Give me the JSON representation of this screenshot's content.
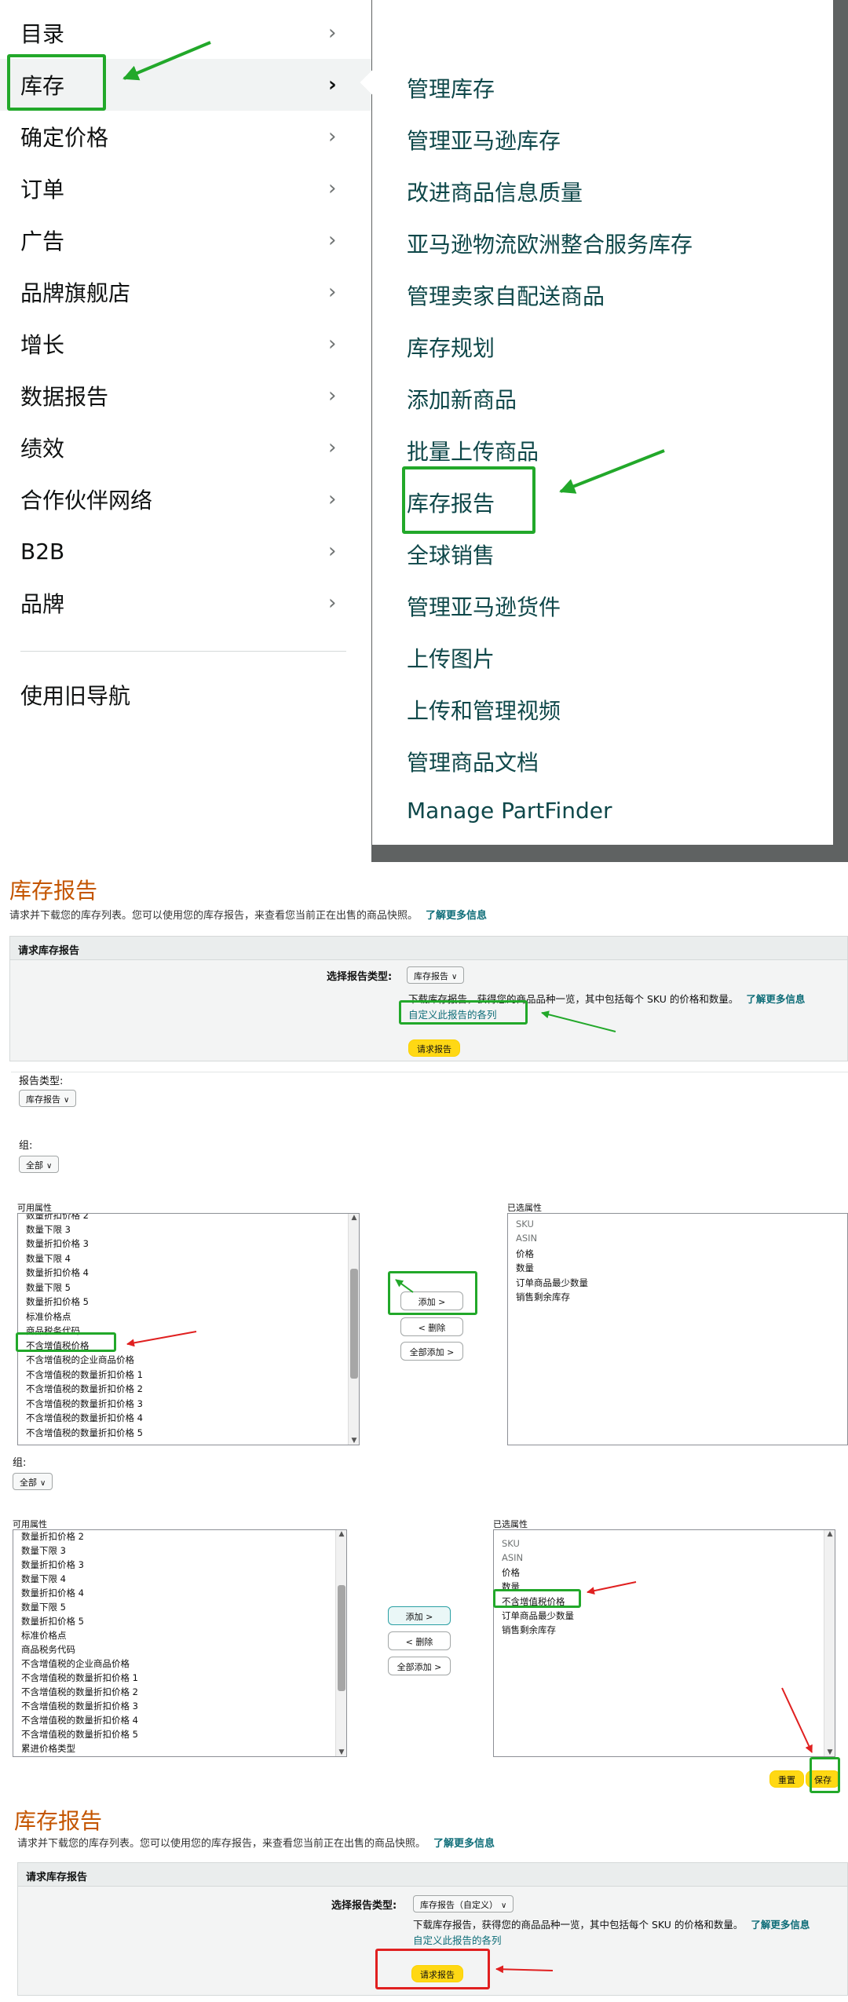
{
  "nav": {
    "left_items": [
      {
        "label": "目录"
      },
      {
        "label": "库存"
      },
      {
        "label": "确定价格"
      },
      {
        "label": "订单"
      },
      {
        "label": "广告"
      },
      {
        "label": "品牌旗舰店"
      },
      {
        "label": "增长"
      },
      {
        "label": "数据报告"
      },
      {
        "label": "绩效"
      },
      {
        "label": "合作伙伴网络"
      },
      {
        "label": "B2B"
      },
      {
        "label": "品牌"
      }
    ],
    "chevron": "›",
    "old_nav": "使用旧导航",
    "sub_items": [
      {
        "label": "管理库存"
      },
      {
        "label": "管理亚马逊库存"
      },
      {
        "label": "改进商品信息质量"
      },
      {
        "label": "亚马逊物流欧洲整合服务库存"
      },
      {
        "label": "管理卖家自配送商品"
      },
      {
        "label": "库存规划"
      },
      {
        "label": "添加新商品"
      },
      {
        "label": "批量上传商品"
      },
      {
        "label": "库存报告"
      },
      {
        "label": "全球销售"
      },
      {
        "label": "管理亚马逊货件"
      },
      {
        "label": "上传图片"
      },
      {
        "label": "上传和管理视频"
      },
      {
        "label": "管理商品文档"
      },
      {
        "label": "Manage PartFinder"
      }
    ]
  },
  "report_top": {
    "title": "库存报告",
    "subtitle": "请求并下载您的库存列表。您可以使用您的库存报告，来查看您当前正在出售的商品快照。",
    "learn_more": "了解更多信息",
    "panel_title": "请求库存报告",
    "type_label": "选择报告类型:",
    "type_value": "库存报告",
    "description": "下载库存报告，获得您的商品品种一览，其中包括每个 SKU 的价格和数量。",
    "customize_link": "自定义此报告的各列",
    "request_button": "请求报告"
  },
  "columns_editor": {
    "report_type_label": "报告类型:",
    "report_type_value": "库存报告",
    "group_label": "组:",
    "group_value": "全部",
    "available_label": "可用属性",
    "selected_label": "已选属性",
    "available_rows_a": [
      "数量折扣价格 2",
      "数量下限 3",
      "数量折扣价格 3",
      "数量下限 4",
      "数量折扣价格 4",
      "数量下限 5",
      "数量折扣价格 5",
      "标准价格点",
      "商品税务代码",
      "不含增值税价格",
      "不含增值税的企业商品价格",
      "不含增值税的数量折扣价格 1",
      "不含增值税的数量折扣价格 2",
      "不含增值税的数量折扣价格 3",
      "不含增值税的数量折扣价格 4",
      "不含增值税的数量折扣价格 5"
    ],
    "selected_rows_a": [
      "SKU",
      "ASIN",
      "价格",
      "数量",
      "订单商品最少数量",
      "销售剩余库存"
    ],
    "add_button": "添加 >",
    "remove_button": "< 删除",
    "add_all_button": "全部添加 >",
    "group_label_2": "组:",
    "group_value_2": "全部",
    "available_label_2": "可用属性",
    "selected_label_2": "已选属性",
    "available_rows_b": [
      "数量折扣价格 2",
      "数量下限 3",
      "数量折扣价格 3",
      "数量下限 4",
      "数量折扣价格 4",
      "数量下限 5",
      "数量折扣价格 5",
      "标准价格点",
      "商品税务代码",
      "不含增值税的企业商品价格",
      "不含增值税的数量折扣价格 1",
      "不含增值税的数量折扣价格 2",
      "不含增值税的数量折扣价格 3",
      "不含增值税的数量折扣价格 4",
      "不含增值税的数量折扣价格 5",
      "累进价格类型"
    ],
    "selected_rows_b": [
      "SKU",
      "ASIN",
      "价格",
      "数量",
      "不含增值税价格",
      "订单商品最少数量",
      "销售剩余库存"
    ],
    "reset_button": "重置",
    "save_button": "保存"
  },
  "report_bottom": {
    "title": "库存报告",
    "subtitle": "请求并下载您的库存列表。您可以使用您的库存报告，来查看您当前正在出售的商品快照。",
    "learn_more": "了解更多信息",
    "panel_title": "请求库存报告",
    "type_label": "选择报告类型:",
    "type_value": "库存报告（自定义）",
    "description": "下载库存报告，获得您的商品品种一览，其中包括每个 SKU 的价格和数量。",
    "customize_link": "自定义此报告的各列",
    "request_button": "请求报告"
  },
  "colors": {
    "highlight": "#22a82a",
    "arrow_red": "#e02020",
    "title_orange": "#c45500",
    "link_teal": "#0e6d78",
    "button_yellow": "#ffd814"
  }
}
